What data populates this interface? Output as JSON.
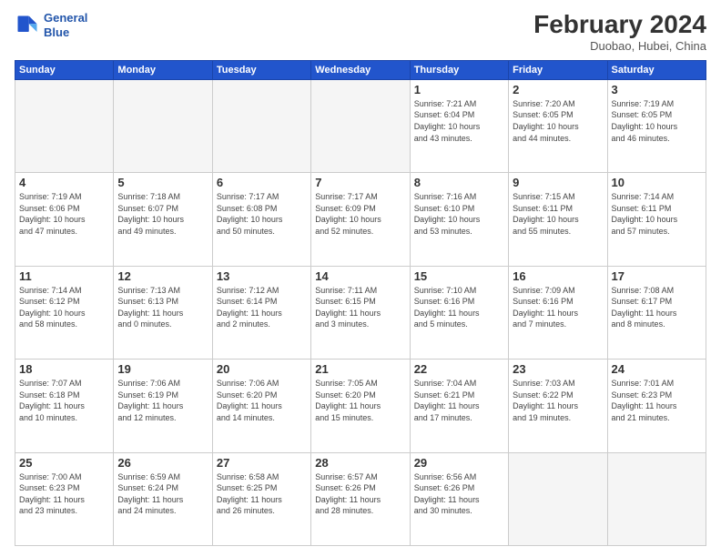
{
  "header": {
    "logo_line1": "General",
    "logo_line2": "Blue",
    "title": "February 2024",
    "location": "Duobao, Hubei, China"
  },
  "days_of_week": [
    "Sunday",
    "Monday",
    "Tuesday",
    "Wednesday",
    "Thursday",
    "Friday",
    "Saturday"
  ],
  "weeks": [
    [
      {
        "day": "",
        "info": ""
      },
      {
        "day": "",
        "info": ""
      },
      {
        "day": "",
        "info": ""
      },
      {
        "day": "",
        "info": ""
      },
      {
        "day": "1",
        "info": "Sunrise: 7:21 AM\nSunset: 6:04 PM\nDaylight: 10 hours\nand 43 minutes."
      },
      {
        "day": "2",
        "info": "Sunrise: 7:20 AM\nSunset: 6:05 PM\nDaylight: 10 hours\nand 44 minutes."
      },
      {
        "day": "3",
        "info": "Sunrise: 7:19 AM\nSunset: 6:05 PM\nDaylight: 10 hours\nand 46 minutes."
      }
    ],
    [
      {
        "day": "4",
        "info": "Sunrise: 7:19 AM\nSunset: 6:06 PM\nDaylight: 10 hours\nand 47 minutes."
      },
      {
        "day": "5",
        "info": "Sunrise: 7:18 AM\nSunset: 6:07 PM\nDaylight: 10 hours\nand 49 minutes."
      },
      {
        "day": "6",
        "info": "Sunrise: 7:17 AM\nSunset: 6:08 PM\nDaylight: 10 hours\nand 50 minutes."
      },
      {
        "day": "7",
        "info": "Sunrise: 7:17 AM\nSunset: 6:09 PM\nDaylight: 10 hours\nand 52 minutes."
      },
      {
        "day": "8",
        "info": "Sunrise: 7:16 AM\nSunset: 6:10 PM\nDaylight: 10 hours\nand 53 minutes."
      },
      {
        "day": "9",
        "info": "Sunrise: 7:15 AM\nSunset: 6:11 PM\nDaylight: 10 hours\nand 55 minutes."
      },
      {
        "day": "10",
        "info": "Sunrise: 7:14 AM\nSunset: 6:11 PM\nDaylight: 10 hours\nand 57 minutes."
      }
    ],
    [
      {
        "day": "11",
        "info": "Sunrise: 7:14 AM\nSunset: 6:12 PM\nDaylight: 10 hours\nand 58 minutes."
      },
      {
        "day": "12",
        "info": "Sunrise: 7:13 AM\nSunset: 6:13 PM\nDaylight: 11 hours\nand 0 minutes."
      },
      {
        "day": "13",
        "info": "Sunrise: 7:12 AM\nSunset: 6:14 PM\nDaylight: 11 hours\nand 2 minutes."
      },
      {
        "day": "14",
        "info": "Sunrise: 7:11 AM\nSunset: 6:15 PM\nDaylight: 11 hours\nand 3 minutes."
      },
      {
        "day": "15",
        "info": "Sunrise: 7:10 AM\nSunset: 6:16 PM\nDaylight: 11 hours\nand 5 minutes."
      },
      {
        "day": "16",
        "info": "Sunrise: 7:09 AM\nSunset: 6:16 PM\nDaylight: 11 hours\nand 7 minutes."
      },
      {
        "day": "17",
        "info": "Sunrise: 7:08 AM\nSunset: 6:17 PM\nDaylight: 11 hours\nand 8 minutes."
      }
    ],
    [
      {
        "day": "18",
        "info": "Sunrise: 7:07 AM\nSunset: 6:18 PM\nDaylight: 11 hours\nand 10 minutes."
      },
      {
        "day": "19",
        "info": "Sunrise: 7:06 AM\nSunset: 6:19 PM\nDaylight: 11 hours\nand 12 minutes."
      },
      {
        "day": "20",
        "info": "Sunrise: 7:06 AM\nSunset: 6:20 PM\nDaylight: 11 hours\nand 14 minutes."
      },
      {
        "day": "21",
        "info": "Sunrise: 7:05 AM\nSunset: 6:20 PM\nDaylight: 11 hours\nand 15 minutes."
      },
      {
        "day": "22",
        "info": "Sunrise: 7:04 AM\nSunset: 6:21 PM\nDaylight: 11 hours\nand 17 minutes."
      },
      {
        "day": "23",
        "info": "Sunrise: 7:03 AM\nSunset: 6:22 PM\nDaylight: 11 hours\nand 19 minutes."
      },
      {
        "day": "24",
        "info": "Sunrise: 7:01 AM\nSunset: 6:23 PM\nDaylight: 11 hours\nand 21 minutes."
      }
    ],
    [
      {
        "day": "25",
        "info": "Sunrise: 7:00 AM\nSunset: 6:23 PM\nDaylight: 11 hours\nand 23 minutes."
      },
      {
        "day": "26",
        "info": "Sunrise: 6:59 AM\nSunset: 6:24 PM\nDaylight: 11 hours\nand 24 minutes."
      },
      {
        "day": "27",
        "info": "Sunrise: 6:58 AM\nSunset: 6:25 PM\nDaylight: 11 hours\nand 26 minutes."
      },
      {
        "day": "28",
        "info": "Sunrise: 6:57 AM\nSunset: 6:26 PM\nDaylight: 11 hours\nand 28 minutes."
      },
      {
        "day": "29",
        "info": "Sunrise: 6:56 AM\nSunset: 6:26 PM\nDaylight: 11 hours\nand 30 minutes."
      },
      {
        "day": "",
        "info": ""
      },
      {
        "day": "",
        "info": ""
      }
    ]
  ]
}
